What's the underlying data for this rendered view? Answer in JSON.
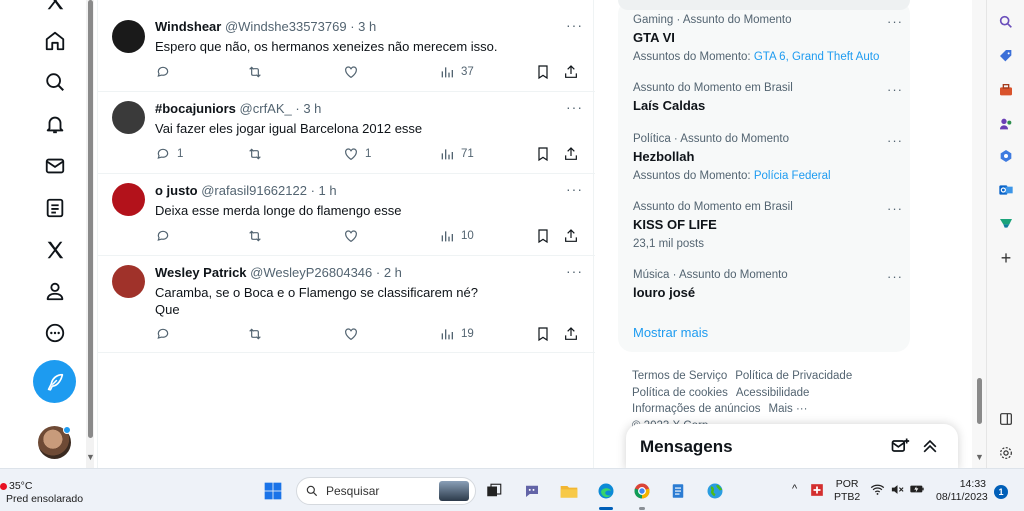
{
  "tweets": [
    {
      "name": "Windshear",
      "handle": "@Windshe33573769",
      "time": "· 3 h",
      "text": "Espero que não, os hermanos xeneizes não merecem isso.",
      "text2": "",
      "replies": "",
      "retweets": "",
      "likes": "",
      "views": "37",
      "avatar_color": "#1a1a1a"
    },
    {
      "name": "#bocajuniors",
      "handle": "@crfAK_",
      "time": "· 3 h",
      "text": "Vai fazer eles jogar igual Barcelona 2012 esse",
      "text2": "",
      "replies": "1",
      "retweets": "",
      "likes": "1",
      "views": "71",
      "avatar_color": "#3a3a3a"
    },
    {
      "name": "o justo",
      "handle": "@rafasil91662122",
      "time": "· 1 h",
      "text": "Deixa esse merda longe do flamengo esse",
      "text2": "",
      "replies": "",
      "retweets": "",
      "likes": "",
      "views": "10",
      "avatar_color": "#b3121b"
    },
    {
      "name": "Wesley Patrick",
      "handle": "@WesleyP26804346",
      "time": "· 2 h",
      "text": "Caramba, se o Boca e o Flamengo se classificarem né?",
      "text2": "Que",
      "replies": "",
      "retweets": "",
      "likes": "",
      "views": "19",
      "avatar_color": "#a0322a"
    }
  ],
  "trends": [
    {
      "meta": "Gaming · Assunto do Momento",
      "name": "GTA VI",
      "sub_prefix": "Assuntos do Momento:",
      "sub_links": "GTA 6, Grand Theft Auto",
      "sub_plain": ""
    },
    {
      "meta": "Assunto do Momento em Brasil",
      "name": "Laís Caldas",
      "sub_prefix": "",
      "sub_links": "",
      "sub_plain": ""
    },
    {
      "meta": "Política · Assunto do Momento",
      "name": "Hezbollah",
      "sub_prefix": "Assuntos do Momento:",
      "sub_links": "Polícia Federal",
      "sub_plain": ""
    },
    {
      "meta": "Assunto do Momento em Brasil",
      "name": "KISS OF LIFE",
      "sub_prefix": "",
      "sub_links": "",
      "sub_plain": "23,1 mil posts"
    },
    {
      "meta": "Música · Assunto do Momento",
      "name": "louro josé",
      "sub_prefix": "",
      "sub_links": "",
      "sub_plain": ""
    }
  ],
  "show_more": "Mostrar mais",
  "more_dots": "···",
  "footer": {
    "terms": "Termos de Serviço",
    "privacy": "Política de Privacidade",
    "cookies": "Política de cookies",
    "accessibility": "Acessibilidade",
    "ads": "Informações de anúncios",
    "more": "Mais ···",
    "copyright": "© 2023 X Corp."
  },
  "messages": {
    "title": "Mensagens"
  },
  "taskbar": {
    "temperature": "35°C",
    "weather_desc": "Pred ensolarado",
    "search_label": "Pesquisar",
    "lang1": "POR",
    "lang2": "PTB2",
    "time": "14:33",
    "date": "08/11/2023",
    "notifications": "1"
  },
  "colors": {
    "accent": "#1d9bf0",
    "text_primary": "#0f1419",
    "text_secondary": "#536471"
  }
}
